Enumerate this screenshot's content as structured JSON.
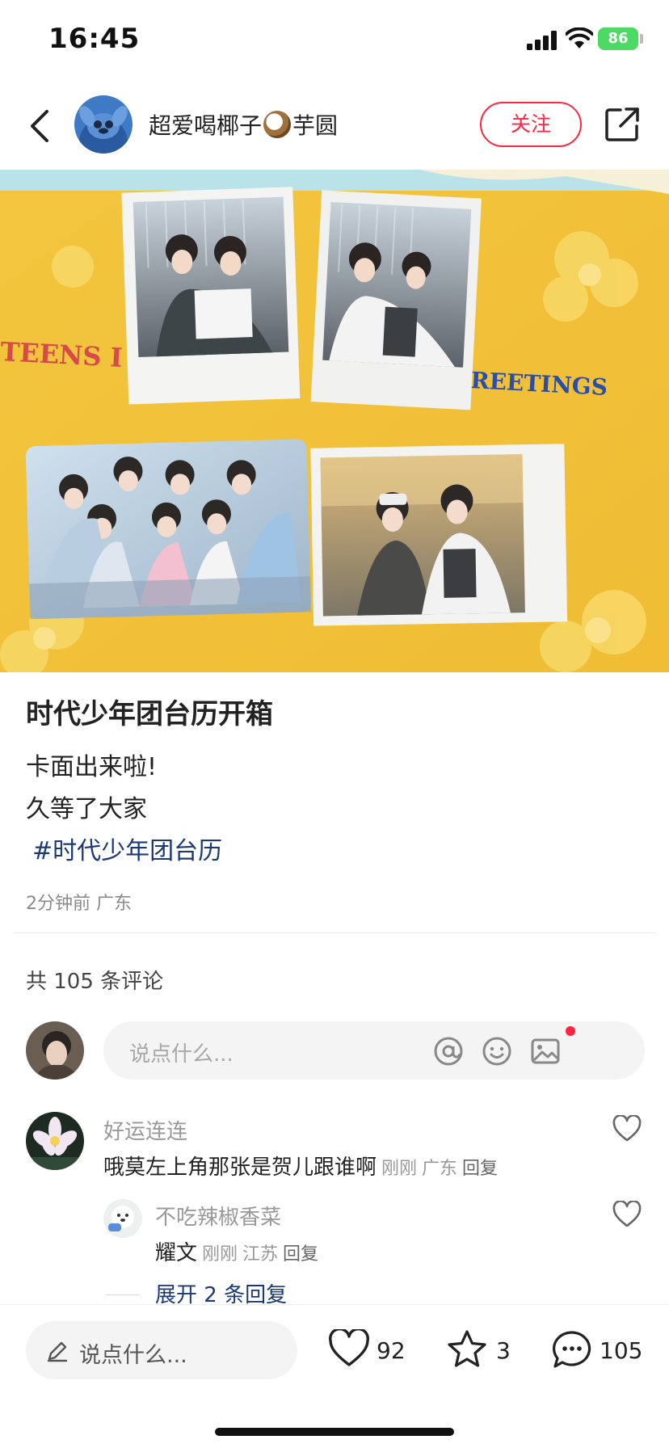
{
  "status_bar": {
    "time": "16:45",
    "battery": "86"
  },
  "header": {
    "username": "超爱喝椰子",
    "username_suffix": "芋圆",
    "follow_label": "关注"
  },
  "photo": {
    "text_left": "TEENS I",
    "text_right": "REETINGS"
  },
  "post": {
    "title": "时代少年团台历开箱",
    "lines": [
      "卡面出来啦!",
      "久等了大家"
    ],
    "hashtag": "#时代少年团台历",
    "meta": "2分钟前 广东"
  },
  "comments_section": {
    "count_label": "共 105 条评论",
    "input_placeholder": "说点什么...",
    "comments": [
      {
        "name": "好运连连",
        "text": "哦莫左上角那张是贺儿跟谁啊",
        "time": "刚刚",
        "location": "广东",
        "reply_label": "回复"
      }
    ],
    "reply": {
      "name": "不吃辣椒香菜",
      "text": "耀文",
      "time": "刚刚",
      "location": "江苏",
      "reply_label": "回复"
    },
    "expand_label": "展开 2 条回复"
  },
  "bottom_bar": {
    "input_placeholder": "说点什么...",
    "likes": "92",
    "favorites": "3",
    "comments": "105"
  },
  "colors": {
    "accent": "#ff2442",
    "link": "#1b3a75"
  }
}
